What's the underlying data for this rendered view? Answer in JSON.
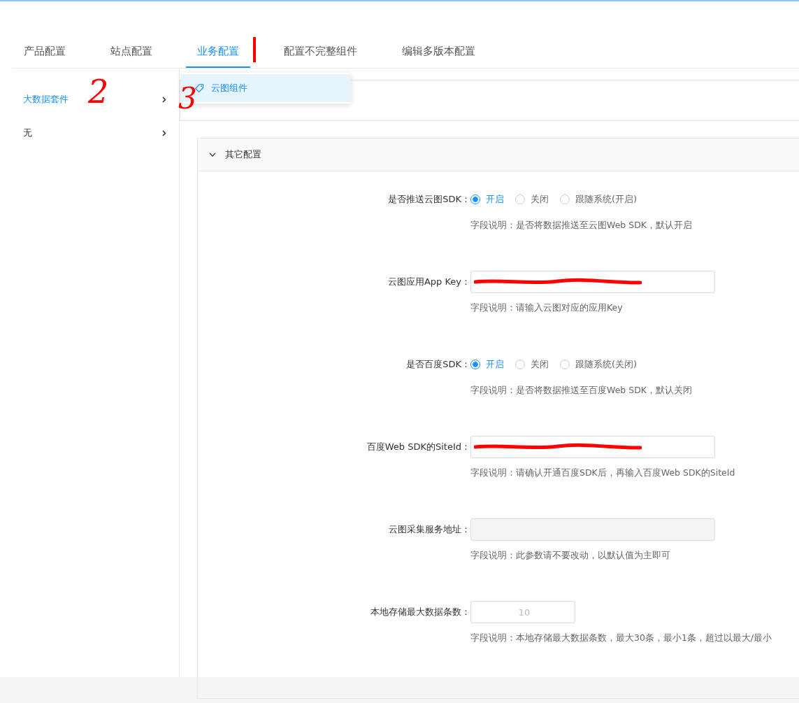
{
  "tabs": [
    {
      "label": "产品配置",
      "selected": false
    },
    {
      "label": "站点配置",
      "selected": false
    },
    {
      "label": "业务配置",
      "selected": true
    },
    {
      "label": "配置不完整组件",
      "selected": false
    },
    {
      "label": "编辑多版本配置",
      "selected": false
    }
  ],
  "sidebar": {
    "items": [
      {
        "label": "大数据套件",
        "selected": true
      },
      {
        "label": "无",
        "selected": false
      }
    ]
  },
  "submenu": {
    "items": [
      {
        "label": "云图组件",
        "selected": true
      }
    ]
  },
  "panel": {
    "title": "其它配置",
    "expanded": true,
    "fields": [
      {
        "kind": "radio",
        "label": "是否推送云图SDK：",
        "options": [
          {
            "label": "开启",
            "selected": true
          },
          {
            "label": "关闭",
            "selected": false
          },
          {
            "label": "跟随系统(开启)",
            "selected": false
          }
        ],
        "help": "字段说明：是否将数据推送至云图Web SDK，默认开启"
      },
      {
        "kind": "text",
        "label": "云图应用App Key：",
        "redacted": true,
        "help": "字段说明：请输入云图对应的应用Key"
      },
      {
        "kind": "radio",
        "label": "是否百度SDK：",
        "options": [
          {
            "label": "开启",
            "selected": true
          },
          {
            "label": "关闭",
            "selected": false
          },
          {
            "label": "跟随系统(关闭)",
            "selected": false
          }
        ],
        "help": "字段说明：是否将数据推送至百度Web SDK，默认关闭"
      },
      {
        "kind": "text",
        "label": "百度Web SDK的SiteId：",
        "redacted": true,
        "help": "字段说明：请确认开通百度SDK后，再输入百度Web SDK的SiteId"
      },
      {
        "kind": "text",
        "label": "云图采集服务地址：",
        "disabled": true,
        "help": "字段说明：此参数请不要改动，以默认值为主即可"
      },
      {
        "kind": "number",
        "label": "本地存储最大数据条数：",
        "value": "10",
        "help": "字段说明：本地存储最大数据条数，最大30条，最小1条，超过以最大/最小"
      }
    ]
  },
  "annotations": [
    {
      "kind": "line"
    },
    {
      "kind": "text",
      "text": "2"
    },
    {
      "kind": "text",
      "text": "3"
    }
  ]
}
